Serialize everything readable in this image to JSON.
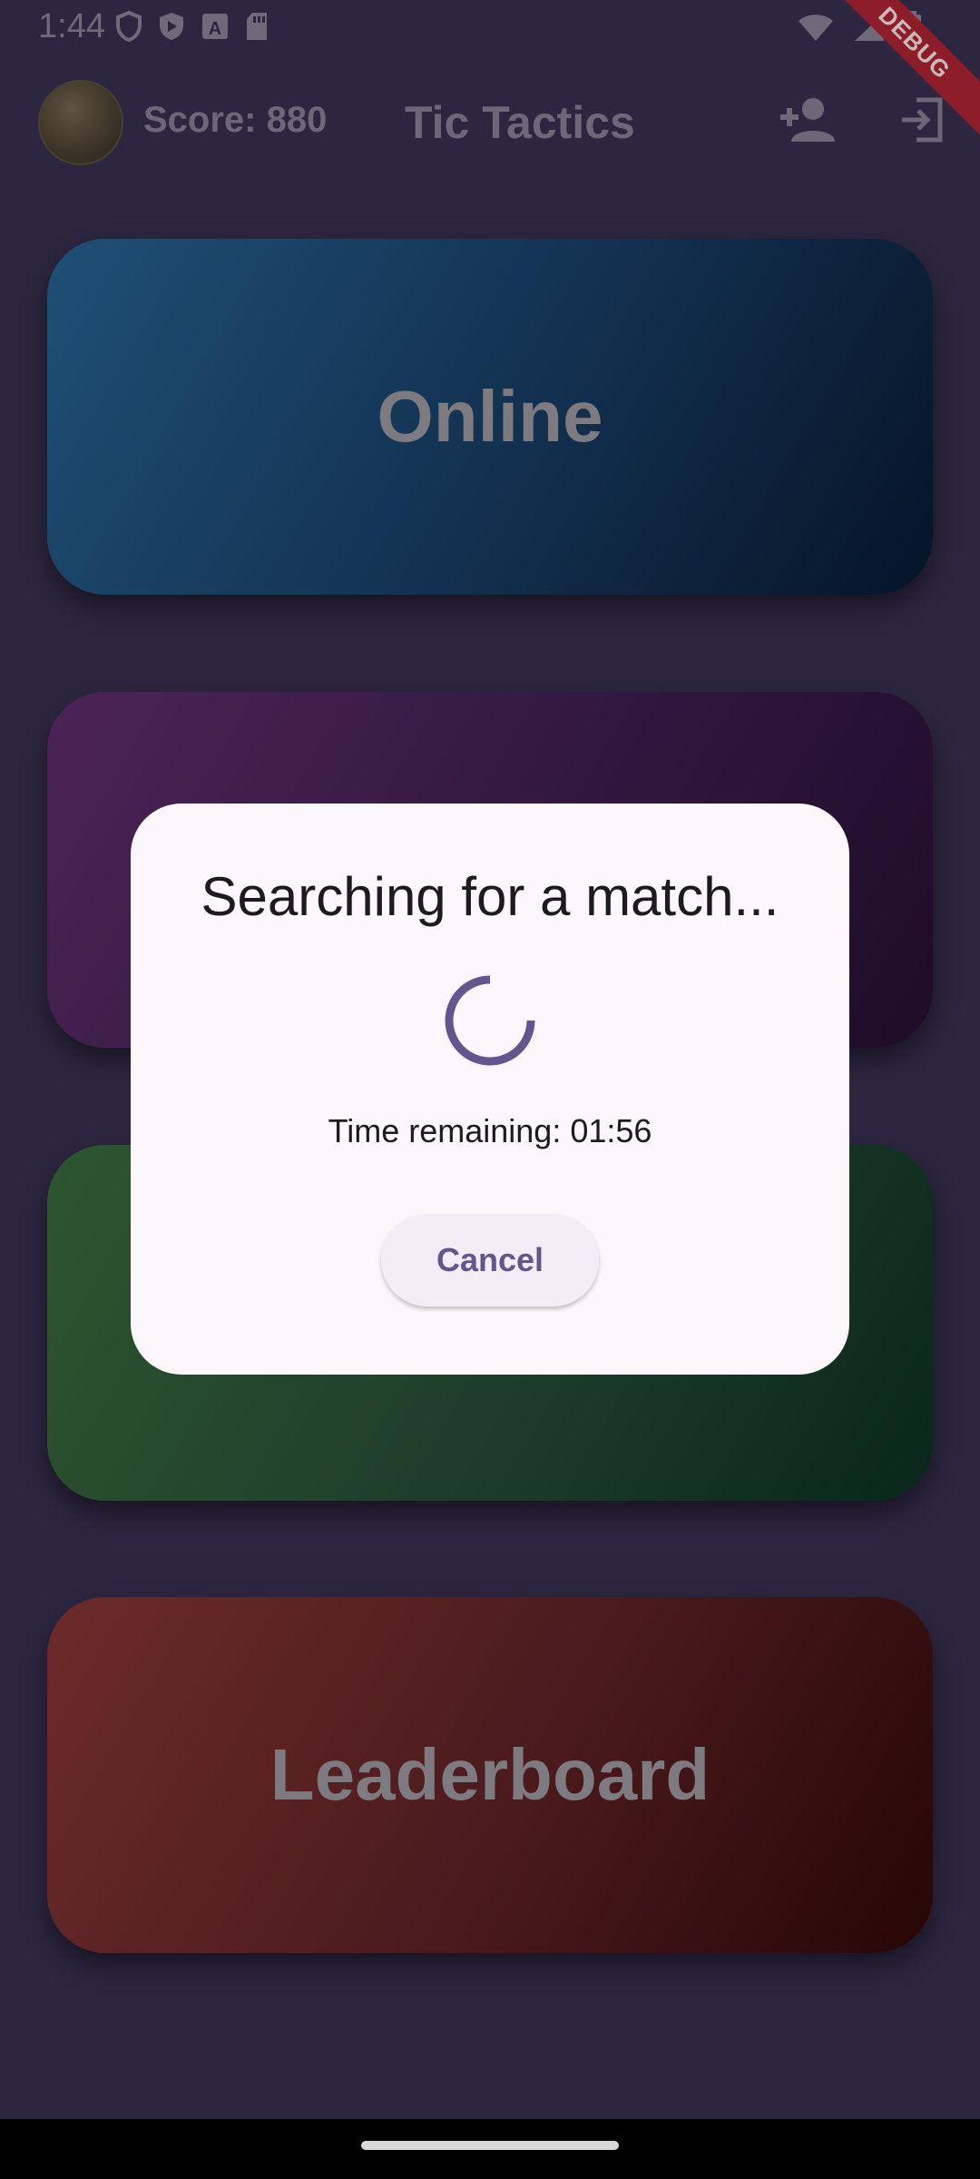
{
  "status_bar": {
    "time": "1:44",
    "left_icons": [
      "shield-icon",
      "play-protect-icon",
      "a-box-icon",
      "sd-card-icon"
    ],
    "right_icons": [
      "wifi-icon",
      "signal-icon",
      "battery-icon"
    ]
  },
  "debug_banner": "DEBUG",
  "app_bar": {
    "score": "Score: 880",
    "title": "Tic Tactics",
    "actions": [
      "add-person-icon",
      "logout-icon"
    ]
  },
  "menu": {
    "online": "Online",
    "leaderboard": "Leaderboard"
  },
  "dialog": {
    "title": "Searching for a match...",
    "time_remaining": "Time remaining: 01:56",
    "cancel": "Cancel"
  },
  "colors": {
    "accent": "#65558f",
    "dialog_bg": "#fdf7fc",
    "background": "#2d2640"
  }
}
